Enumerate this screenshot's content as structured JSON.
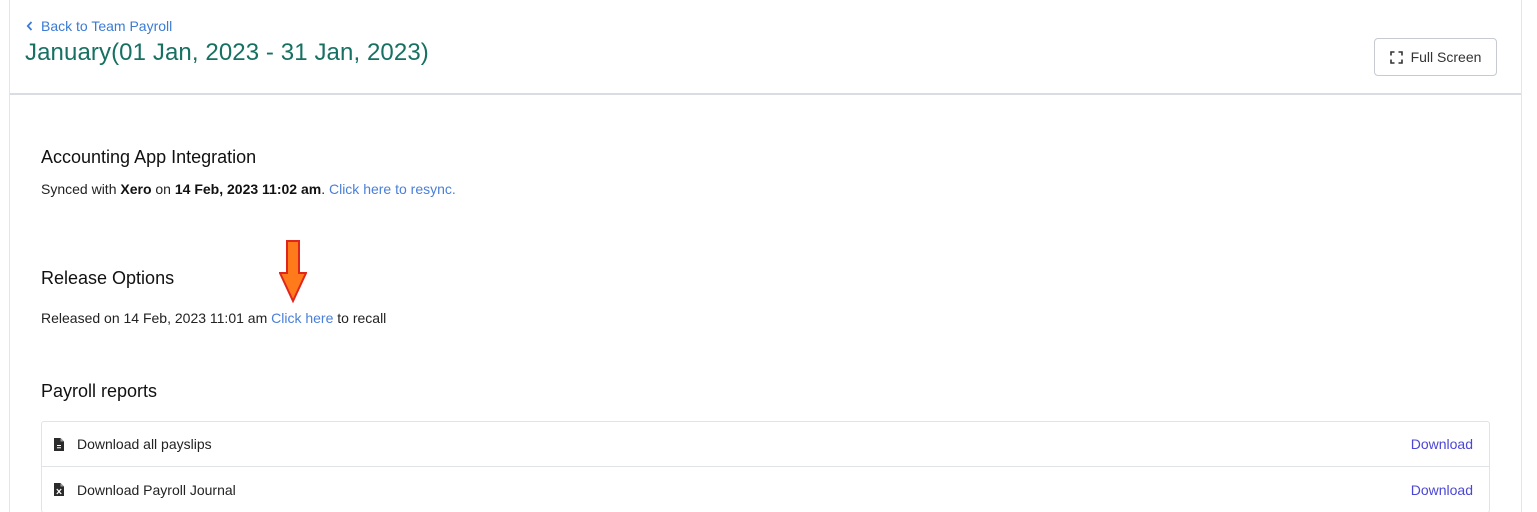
{
  "header": {
    "back_label": "Back to Team Payroll",
    "title": "January(01 Jan, 2023 - 31 Jan, 2023)",
    "fullscreen_label": "Full Screen"
  },
  "integration": {
    "title": "Accounting App Integration",
    "text_prefix": "Synced with ",
    "app_name": "Xero",
    "text_on": " on ",
    "synced_at": "14 Feb, 2023 11:02 am",
    "text_period": ". ",
    "resync_link": "Click here to resync."
  },
  "release": {
    "title": "Release Options",
    "text_prefix": "Released on 14 Feb, 2023 11:01 am ",
    "recall_link": "Click here",
    "text_suffix": " to recall"
  },
  "reports": {
    "title": "Payroll reports",
    "items": [
      {
        "label": "Download all payslips",
        "action": "Download",
        "icon": "file-icon"
      },
      {
        "label": "Download Payroll Journal",
        "action": "Download",
        "icon": "excel-file-icon"
      }
    ]
  },
  "colors": {
    "title_green": "#177062",
    "link_blue": "#4a7fd8",
    "download_blue": "#4b47d6",
    "annotation_arrow": "#ff7a1a"
  }
}
